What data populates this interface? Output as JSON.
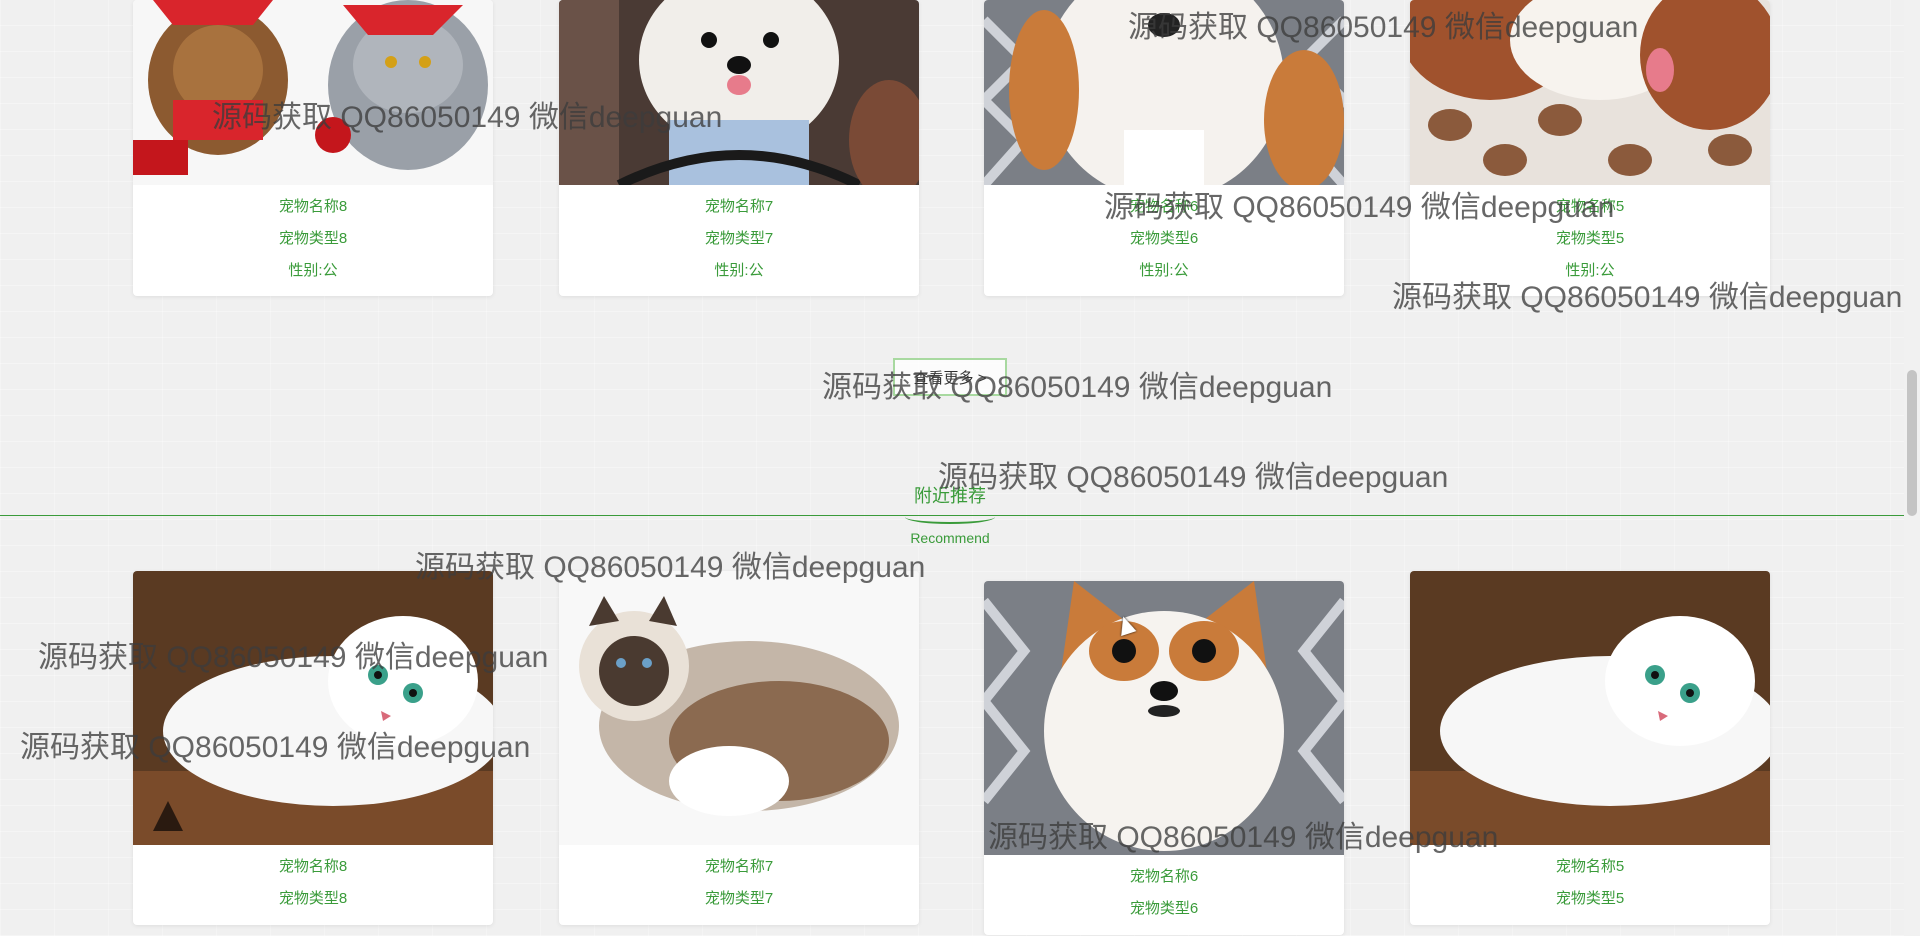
{
  "top_row": [
    {
      "name": "宠物名称8",
      "type": "宠物类型8",
      "gender": "性别:公",
      "image": "pets-christmas-dog-and-cat"
    },
    {
      "name": "宠物名称7",
      "type": "宠物类型7",
      "gender": "性别:公",
      "image": "white-poodle-in-car"
    },
    {
      "name": "宠物名称6",
      "type": "宠物类型6",
      "gender": "性别:公",
      "image": "chihuahua-dog"
    },
    {
      "name": "宠物名称5",
      "type": "宠物类型5",
      "gender": "性别:公",
      "image": "spaniel-puppy-on-cushion"
    }
  ],
  "more_button": "查看更多 >",
  "recommend": {
    "title": "附近推荐",
    "subtitle": "Recommend"
  },
  "bottom_row": [
    {
      "name": "宠物名称8",
      "type": "宠物类型8",
      "image": "white-cat-on-brown"
    },
    {
      "name": "宠物名称7",
      "type": "宠物类型7",
      "image": "ragdoll-cat"
    },
    {
      "name": "宠物名称6",
      "type": "宠物类型6",
      "image": "papillon-dog"
    },
    {
      "name": "宠物名称5",
      "type": "宠物类型5",
      "image": "white-cat-on-brown"
    }
  ],
  "watermark_text": "源码获取 QQ86050149 微信deepguan",
  "colors": {
    "accent_green": "#3a9b3a",
    "background": "#f0f0f0"
  }
}
